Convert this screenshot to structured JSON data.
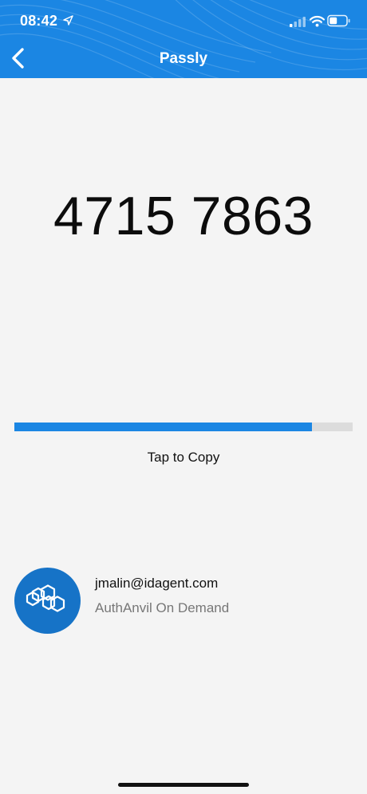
{
  "status_bar": {
    "time": "08:42",
    "icons": [
      "location-arrow-icon",
      "cellular-signal-icon",
      "wifi-icon",
      "battery-icon"
    ]
  },
  "nav": {
    "title": "Passly",
    "back_icon": "chevron-left-icon"
  },
  "otp": {
    "code": "4715 7863",
    "time_remaining_fraction": 0.88,
    "copy_hint": "Tap to Copy"
  },
  "account": {
    "email": "jmalin@idagent.com",
    "issuer": "AuthAnvil On Demand",
    "logo_icon": "hexagon-logo-icon"
  },
  "colors": {
    "accent": "#1b86e3",
    "progress_track": "#dcdcdc",
    "background": "#f4f4f4",
    "logo_bg": "#1673c7"
  }
}
